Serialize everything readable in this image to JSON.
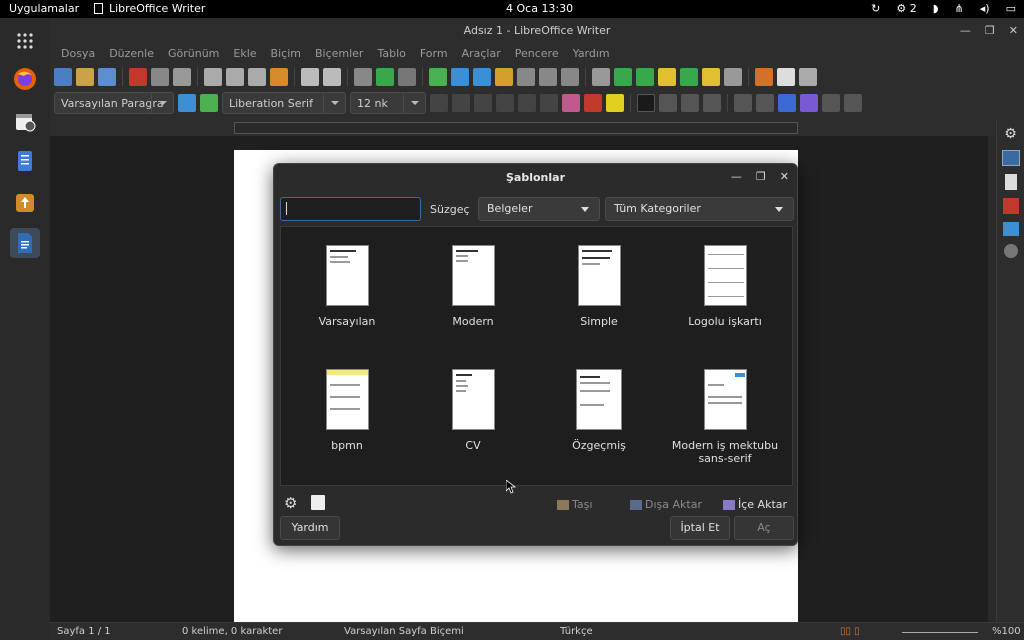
{
  "topbar": {
    "apps_label": "Uygulamalar",
    "active_app": "LibreOffice Writer",
    "clock": "4 Oca  13:30",
    "tray_count": "2"
  },
  "window": {
    "title": "Adsız 1 - LibreOffice Writer"
  },
  "menu": [
    "Dosya",
    "Düzenle",
    "Görünüm",
    "Ekle",
    "Biçim",
    "Biçemler",
    "Tablo",
    "Form",
    "Araçlar",
    "Pencere",
    "Yardım"
  ],
  "formatting": {
    "paragraph_style": "Varsayılan Paragra",
    "font_name": "Liberation Serif",
    "font_size": "12 nk"
  },
  "dialog": {
    "title": "Şablonlar",
    "search_value": "",
    "filter_label": "Süzgeç",
    "doc_type": "Belgeler",
    "category": "Tüm Kategoriler",
    "templates": [
      {
        "name": "Varsayılan"
      },
      {
        "name": "Modern"
      },
      {
        "name": "Simple"
      },
      {
        "name": "Logolu işkartı"
      },
      {
        "name": "bpmn"
      },
      {
        "name": "CV"
      },
      {
        "name": "Özgeçmiş"
      },
      {
        "name": "Modern iş mektubu sans-serif"
      }
    ],
    "move_label": "Taşı",
    "export_label": "Dışa Aktar",
    "import_label": "İçe Aktar",
    "help_label": "Yardım",
    "cancel_label": "İptal Et",
    "open_label": "Aç"
  },
  "status": {
    "page": "Sayfa 1 / 1",
    "words": "0 kelime, 0 karakter",
    "page_style": "Varsayılan Sayfa Biçemi",
    "language": "Türkçe",
    "zoom": "%100"
  },
  "colors": {
    "accent": "#3b6aa0",
    "dialog_bg": "#2b2b2b",
    "grid_bg": "#1e1e1e"
  }
}
